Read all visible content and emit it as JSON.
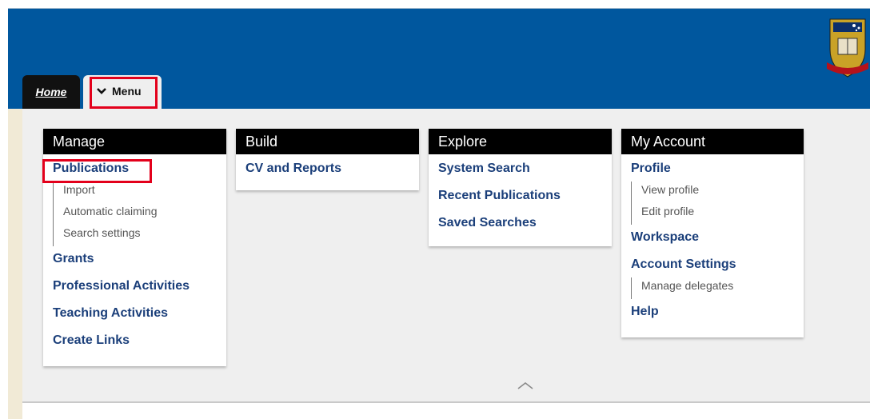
{
  "tabs": {
    "home_label": "Home",
    "menu_label": "Menu"
  },
  "columns": [
    {
      "title": "Manage",
      "items": [
        {
          "label": "Publications",
          "subitems": [
            "Import",
            "Automatic claiming",
            "Search settings"
          ]
        },
        {
          "label": "Grants"
        },
        {
          "label": "Professional Activities"
        },
        {
          "label": "Teaching Activities"
        },
        {
          "label": "Create Links"
        }
      ]
    },
    {
      "title": "Build",
      "items": [
        {
          "label": "CV and Reports"
        }
      ]
    },
    {
      "title": "Explore",
      "items": [
        {
          "label": "System Search"
        },
        {
          "label": "Recent Publications"
        },
        {
          "label": "Saved Searches"
        }
      ]
    },
    {
      "title": "My Account",
      "items": [
        {
          "label": "Profile",
          "subitems": [
            "View profile",
            "Edit profile"
          ]
        },
        {
          "label": "Workspace"
        },
        {
          "label": "Account Settings",
          "subitems": [
            "Manage delegates"
          ]
        },
        {
          "label": "Help"
        }
      ]
    }
  ],
  "colors": {
    "header_blue": "#00579e",
    "link_blue": "#1b3f7a",
    "highlight_red": "#e3001b"
  },
  "icons": {
    "menu_toggle": "chevron-down-icon",
    "collapse": "chevron-up-icon",
    "logo": "university-crest-icon"
  }
}
